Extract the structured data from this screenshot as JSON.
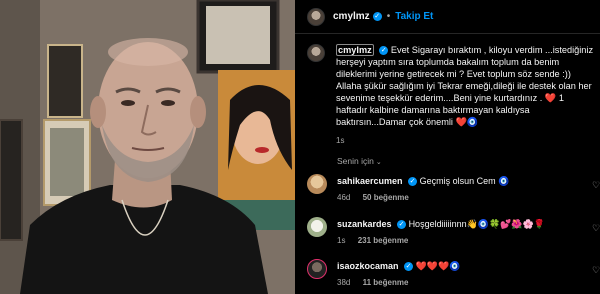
{
  "post": {
    "username": "cmylmz",
    "follow_label": "Takip Et",
    "separator": "•",
    "caption_user": "cmylmz",
    "caption_text": "Evet Sigarayı bıraktım , kiloyu verdim ...istediğiniz herşeyi yaptım sıra toplumda bakalım toplum da benim dileklerimi yerine getirecek mi ? Evet toplum söz sende :)) Allaha şükür sağlığım iyi Tekrar emeği,dileği ile destek olan her sevenime teşekkür ederim....Beni yine kurtardınız . ❤️ 1 haftadır kalbine damarına baktırmayan kaldıysa baktırsın...Damar çok önemli ❤️🧿",
    "caption_time": "1s"
  },
  "section_label": "Senin için",
  "comments": [
    {
      "username": "sahikaercumen",
      "text": "Geçmiş olsun Cem 🧿",
      "time": "46d",
      "likes": "50 beğenme",
      "avatar_color": "#d9b48a"
    },
    {
      "username": "suzankardes",
      "text": "Hoşgeldiiiiinnn👋🧿🍀💕🌺🌸🌹",
      "time": "1s",
      "likes": "231 beğenme",
      "avatar_color": "#c8d0b8"
    },
    {
      "username": "isaozkocaman",
      "text": "❤️❤️❤️🧿",
      "time": "38d",
      "likes": "11 beğenme",
      "avatar_color": "#3a3a3a"
    }
  ],
  "colors": {
    "accent": "#0095f6",
    "muted": "#a8a8a8",
    "background": "#000000"
  }
}
